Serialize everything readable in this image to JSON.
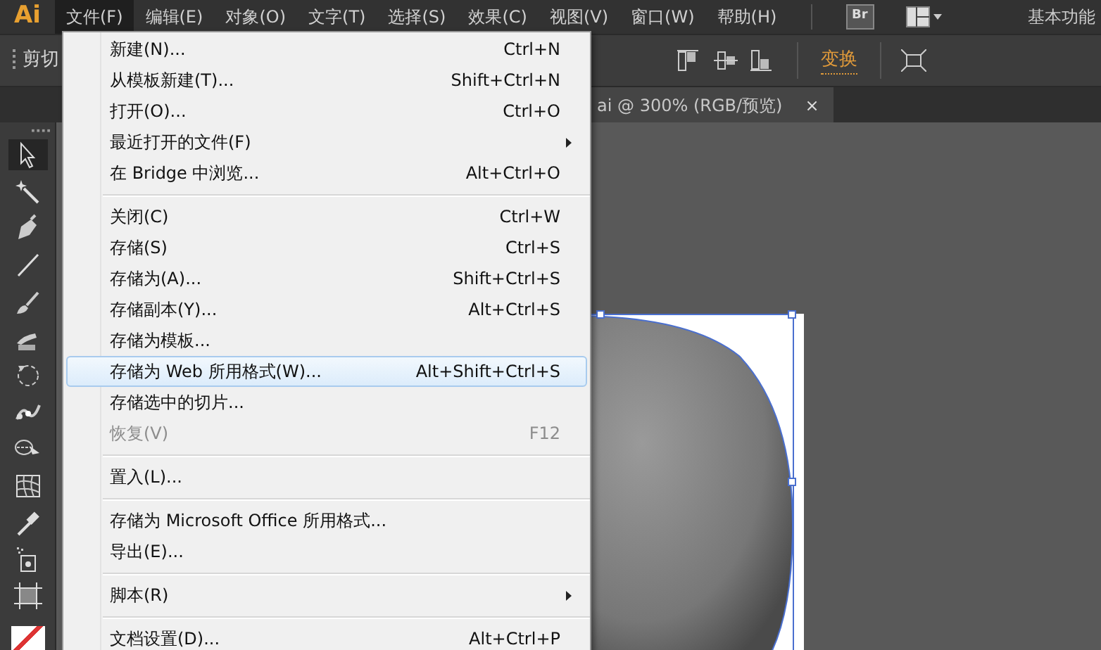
{
  "menubar": {
    "logo": "Ai",
    "menus": [
      {
        "label": "文件(F)",
        "selected": true
      },
      {
        "label": "编辑(E)",
        "selected": false
      },
      {
        "label": "对象(O)",
        "selected": false
      },
      {
        "label": "文字(T)",
        "selected": false
      },
      {
        "label": "选择(S)",
        "selected": false
      },
      {
        "label": "效果(C)",
        "selected": false
      },
      {
        "label": "视图(V)",
        "selected": false
      },
      {
        "label": "窗口(W)",
        "selected": false
      },
      {
        "label": "帮助(H)",
        "selected": false
      }
    ],
    "bridge_button": "Br",
    "workspace": "基本功能"
  },
  "control_bar": {
    "label": "剪切",
    "transform": "变换"
  },
  "document_tab": {
    "title": "ai @ 300% (RGB/预览)",
    "close": "×"
  },
  "tools": [
    {
      "kind": "selection",
      "selected": true
    },
    {
      "kind": "wand",
      "selected": false
    },
    {
      "kind": "pen",
      "selected": false
    },
    {
      "kind": "line",
      "selected": false
    },
    {
      "kind": "brush",
      "selected": false
    },
    {
      "kind": "blob",
      "selected": false
    },
    {
      "kind": "rotate",
      "selected": false
    },
    {
      "kind": "puppet",
      "selected": false
    },
    {
      "kind": "builder",
      "selected": false
    },
    {
      "kind": "mesh",
      "selected": false
    },
    {
      "kind": "eyedropper",
      "selected": false
    },
    {
      "kind": "sprayer",
      "selected": false
    },
    {
      "kind": "artboard",
      "selected": false
    }
  ],
  "file_menu": {
    "items": [
      {
        "kind": "item",
        "label": "新建(N)...",
        "shortcut": "Ctrl+N",
        "selected": false,
        "disabled": false
      },
      {
        "kind": "item",
        "label": "从模板新建(T)...",
        "shortcut": "Shift+Ctrl+N",
        "selected": false,
        "disabled": false
      },
      {
        "kind": "item",
        "label": "打开(O)...",
        "shortcut": "Ctrl+O",
        "selected": false,
        "disabled": false
      },
      {
        "kind": "submenu",
        "label": "最近打开的文件(F)",
        "selected": false,
        "disabled": false
      },
      {
        "kind": "item",
        "label": "在 Bridge 中浏览...",
        "shortcut": "Alt+Ctrl+O",
        "selected": false,
        "disabled": false
      },
      {
        "kind": "separator"
      },
      {
        "kind": "item",
        "label": "关闭(C)",
        "shortcut": "Ctrl+W",
        "selected": false,
        "disabled": false
      },
      {
        "kind": "item",
        "label": "存储(S)",
        "shortcut": "Ctrl+S",
        "selected": false,
        "disabled": false
      },
      {
        "kind": "item",
        "label": "存储为(A)...",
        "shortcut": "Shift+Ctrl+S",
        "selected": false,
        "disabled": false
      },
      {
        "kind": "item",
        "label": "存储副本(Y)...",
        "shortcut": "Alt+Ctrl+S",
        "selected": false,
        "disabled": false
      },
      {
        "kind": "item",
        "label": "存储为模板...",
        "selected": false,
        "disabled": false
      },
      {
        "kind": "item",
        "label": "存储为 Web 所用格式(W)...",
        "shortcut": "Alt+Shift+Ctrl+S",
        "selected": true,
        "disabled": false
      },
      {
        "kind": "item",
        "label": "存储选中的切片...",
        "selected": false,
        "disabled": false
      },
      {
        "kind": "item",
        "label": "恢复(V)",
        "shortcut": "F12",
        "selected": false,
        "disabled": true
      },
      {
        "kind": "separator"
      },
      {
        "kind": "item",
        "label": "置入(L)...",
        "selected": false,
        "disabled": false
      },
      {
        "kind": "separator"
      },
      {
        "kind": "item",
        "label": "存储为 Microsoft Office 所用格式...",
        "selected": false,
        "disabled": false
      },
      {
        "kind": "item",
        "label": "导出(E)...",
        "selected": false,
        "disabled": false
      },
      {
        "kind": "separator"
      },
      {
        "kind": "submenu",
        "label": "脚本(R)",
        "selected": false,
        "disabled": false
      },
      {
        "kind": "separator"
      },
      {
        "kind": "item",
        "label": "文档设置(D)...",
        "shortcut": "Alt+Ctrl+P",
        "selected": false,
        "disabled": false
      }
    ]
  }
}
